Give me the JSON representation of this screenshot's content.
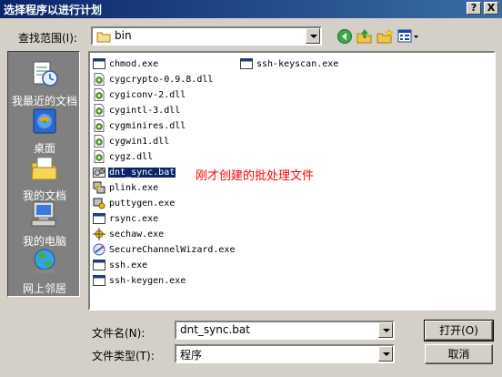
{
  "window": {
    "title": "选择程序以进行计划",
    "help_glyph": "?",
    "close_glyph": "X"
  },
  "lookin": {
    "label": "查找范围(I):",
    "value": "bin",
    "icon": "folder-icon"
  },
  "toolbar": {
    "icons": [
      "back-icon",
      "up-folder-icon",
      "new-folder-icon",
      "view-menu-icon"
    ]
  },
  "places": [
    {
      "label": "我最近的文档",
      "icon": "recent-docs-icon"
    },
    {
      "label": "桌面",
      "icon": "desktop-icon"
    },
    {
      "label": "我的文档",
      "icon": "my-documents-icon"
    },
    {
      "label": "我的电脑",
      "icon": "my-computer-icon"
    },
    {
      "label": "网上邻居",
      "icon": "network-icon"
    }
  ],
  "files": [
    {
      "name": "chmod.exe",
      "icon": "exe-window-icon"
    },
    {
      "name": "cygcrypto-0.9.8.dll",
      "icon": "dll-gear-icon"
    },
    {
      "name": "cygiconv-2.dll",
      "icon": "dll-gear-icon"
    },
    {
      "name": "cygintl-3.dll",
      "icon": "dll-gear-icon"
    },
    {
      "name": "cygminires.dll",
      "icon": "dll-gear-icon"
    },
    {
      "name": "cygwin1.dll",
      "icon": "dll-gear-icon"
    },
    {
      "name": "cygz.dll",
      "icon": "dll-gear-icon"
    },
    {
      "name": "dnt_sync.bat",
      "icon": "batch-gear-icon",
      "selected": true
    },
    {
      "name": "plink.exe",
      "icon": "putty-icon"
    },
    {
      "name": "puttygen.exe",
      "icon": "puttygen-icon"
    },
    {
      "name": "rsync.exe",
      "icon": "exe-window-icon"
    },
    {
      "name": "sechaw.exe",
      "icon": "sechaw-icon"
    },
    {
      "name": "SecureChannelWizard.exe",
      "icon": "wizard-icon"
    },
    {
      "name": "ssh.exe",
      "icon": "exe-window-icon"
    },
    {
      "name": "ssh-keygen.exe",
      "icon": "exe-window-icon"
    },
    {
      "name": "ssh-keyscan.exe",
      "icon": "exe-window-icon"
    }
  ],
  "annotation": "刚才创建的批处理文件",
  "filename": {
    "label": "文件名(N):",
    "value": "dnt_sync.bat"
  },
  "filetype": {
    "label": "文件类型(T):",
    "value": "程序"
  },
  "buttons": {
    "open": "打开(O)",
    "cancel": "取消"
  }
}
